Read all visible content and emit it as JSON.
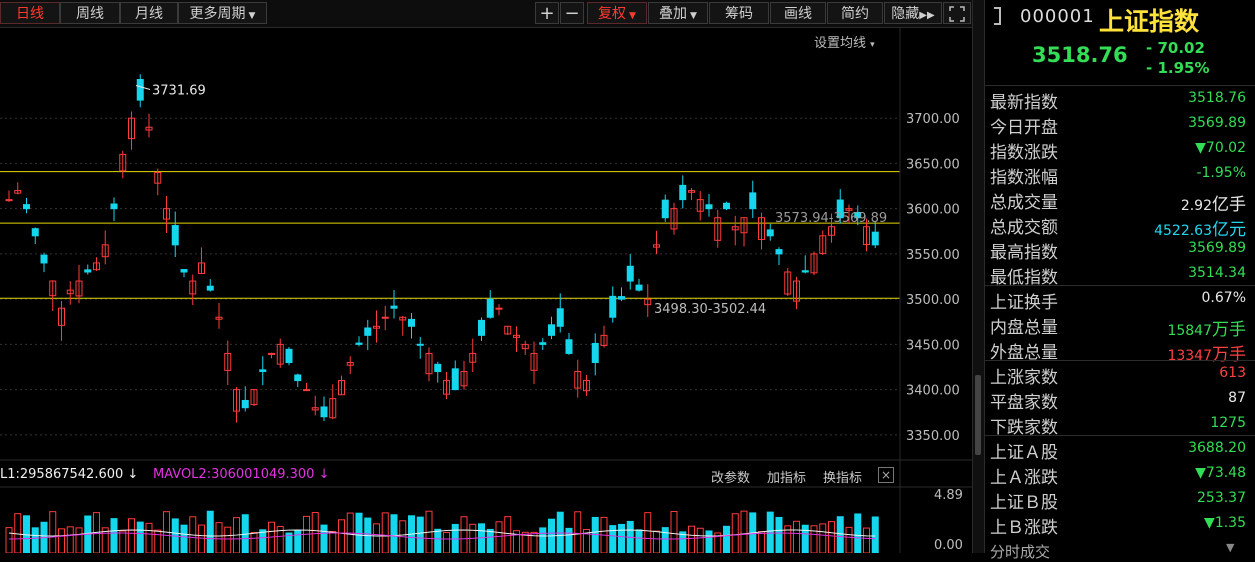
{
  "toolbar": {
    "tabs": [
      {
        "label": "日线",
        "active": true
      },
      {
        "label": "周线",
        "active": false
      },
      {
        "label": "月线",
        "active": false
      },
      {
        "label": "更多周期",
        "active": false
      }
    ],
    "right_buttons": [
      "+",
      "−",
      "复权",
      "叠加",
      "筹码",
      "画线",
      "简约",
      "隐藏"
    ],
    "fullscreen_icon": "fullscreen-icon"
  },
  "chart": {
    "setting_ma_label": "设置均线",
    "high_label": "3731.69",
    "low_label": "3498.30-3502.44",
    "range_label": "3573.94-3569.89",
    "price_axis": [
      "3700.00",
      "3650.00",
      "3600.00",
      "3550.00",
      "3500.00",
      "3450.00",
      "3400.00",
      "3350.00"
    ],
    "vol_axis": [
      "4.89",
      "0.00"
    ],
    "lines": [
      3641,
      3584,
      3501
    ],
    "colors": {
      "up": "#ff3b3b",
      "down": "#14d7ee",
      "hline": "#e6d800",
      "grid": "#333"
    }
  },
  "volume": {
    "ma1": "L1:295867542.600 ↓",
    "ma2": "MAVOL2:306001049.300 ↓",
    "links": [
      "改参数",
      "加指标",
      "换指标"
    ],
    "close": "×"
  },
  "quote": {
    "code": "000001",
    "name": "上证指数",
    "price": "3518.76",
    "change": "- 70.02",
    "change_pct": "- 1.95%",
    "rows": [
      {
        "label": "最新指数",
        "value": "3518.76",
        "color": "green"
      },
      {
        "label": "今日开盘",
        "value": "3569.89",
        "color": "green"
      },
      {
        "label": "指数涨跌",
        "value": "▼70.02",
        "color": "green"
      },
      {
        "label": "指数涨幅",
        "value": "-1.95%",
        "color": "green"
      },
      {
        "label": "总成交量",
        "value": "2.92",
        "unit": "亿手",
        "color": "white"
      },
      {
        "label": "总成交额",
        "value": "4522.63",
        "unit": "亿元",
        "color": "cyan"
      },
      {
        "label": "最高指数",
        "value": "3569.89",
        "color": "green"
      },
      {
        "label": "最低指数",
        "value": "3514.34",
        "color": "green"
      },
      {
        "label": "上证换手",
        "value": "0.67%",
        "color": "white"
      },
      {
        "label": "内盘总量",
        "value": "15847",
        "unit": "万手",
        "color": "green"
      },
      {
        "label": "外盘总量",
        "value": "13347",
        "unit": "万手",
        "color": "red"
      },
      {
        "label": "上涨家数",
        "value": "613",
        "color": "red"
      },
      {
        "label": "平盘家数",
        "value": "87",
        "color": "white"
      },
      {
        "label": "下跌家数",
        "value": "1275",
        "color": "green"
      },
      {
        "label": "上证Ａ股",
        "value": "3688.20",
        "color": "green"
      },
      {
        "label": "上Ａ涨跌",
        "value": "▼73.48",
        "color": "green"
      },
      {
        "label": "上证Ｂ股",
        "value": "253.37",
        "color": "green"
      },
      {
        "label": "上Ｂ涨跌",
        "value": "▼1.35",
        "color": "green"
      }
    ],
    "bottom_label": "分时成交"
  }
}
